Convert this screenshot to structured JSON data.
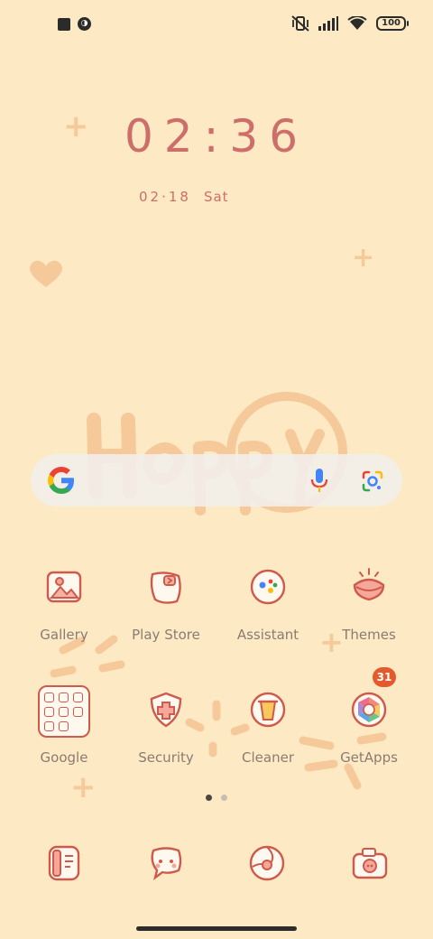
{
  "status_bar": {
    "left_icons": [
      "stop-square-icon",
      "mi-notification-icon"
    ],
    "right_icons": [
      "vibrate-off-icon",
      "signal-icon",
      "wifi-icon",
      "battery-icon"
    ],
    "battery_level": "100"
  },
  "clock": {
    "time": "02:36",
    "date": "02·18",
    "weekday": "Sat"
  },
  "search": {
    "icons": [
      "google-g-icon",
      "mic-icon",
      "google-lens-icon"
    ]
  },
  "apps": [
    {
      "label": "Gallery",
      "icon": "gallery-icon"
    },
    {
      "label": "Play Store",
      "icon": "play-store-icon"
    },
    {
      "label": "Assistant",
      "icon": "assistant-icon"
    },
    {
      "label": "Themes",
      "icon": "themes-icon"
    },
    {
      "label": "Google",
      "icon": "google-folder-icon"
    },
    {
      "label": "Security",
      "icon": "security-icon"
    },
    {
      "label": "Cleaner",
      "icon": "cleaner-icon"
    },
    {
      "label": "GetApps",
      "icon": "getapps-icon",
      "badge": "31"
    }
  ],
  "pager": {
    "pages": 2,
    "current": 1
  },
  "dock": [
    {
      "icon": "phone-icon"
    },
    {
      "icon": "messages-icon"
    },
    {
      "icon": "browser-icon"
    },
    {
      "icon": "camera-icon"
    }
  ],
  "colors": {
    "wallpaper": "#fdeac4",
    "clock_text": "#cd6e6a",
    "icon_stroke": "#cf5a4b",
    "label_text": "#8b7b72",
    "badge": "#e45a2c"
  }
}
